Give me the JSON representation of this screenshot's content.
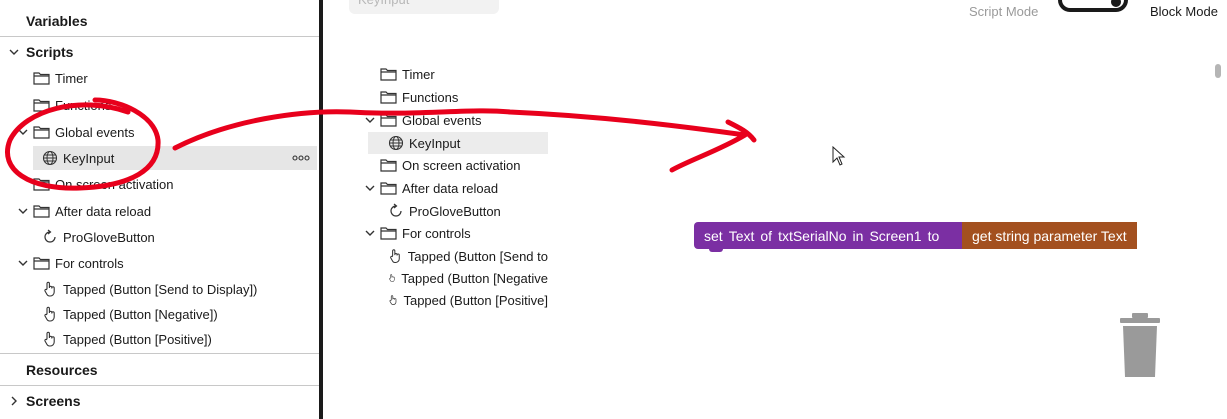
{
  "sidebar": {
    "variables_label": "Variables",
    "scripts_label": "Scripts",
    "resources_label": "Resources",
    "screens_label": "Screens",
    "items": [
      {
        "label": "Timer"
      },
      {
        "label": "Functions"
      },
      {
        "label": "Global events"
      },
      {
        "label": "KeyInput"
      },
      {
        "label": "On screen activation"
      },
      {
        "label": "After data reload"
      },
      {
        "label": "ProGloveButton"
      },
      {
        "label": "For controls"
      },
      {
        "label": "Tapped (Button [Send to Display])"
      },
      {
        "label": "Tapped (Button [Negative])"
      },
      {
        "label": "Tapped (Button [Positive])"
      }
    ],
    "more_label": "ooo"
  },
  "header": {
    "search_value": "KeyInput",
    "script_mode_label": "Script Mode",
    "block_mode_label": "Block Mode"
  },
  "tree": {
    "items": [
      {
        "label": "Timer"
      },
      {
        "label": "Functions"
      },
      {
        "label": "Global events"
      },
      {
        "label": "KeyInput"
      },
      {
        "label": "On screen activation"
      },
      {
        "label": "After data reload"
      },
      {
        "label": "ProGloveButton"
      },
      {
        "label": "For controls"
      },
      {
        "label": "Tapped (Button [Send to"
      },
      {
        "label": "Tapped (Button [Negative"
      },
      {
        "label": "Tapped (Button [Positive]"
      }
    ]
  },
  "blocks": {
    "set_words": [
      "set",
      "Text",
      "of",
      "txtSerialNo",
      "in",
      "Screen1",
      "to"
    ],
    "get_label": "get string parameter Text"
  },
  "colors": {
    "set_block": "#7b2fa3",
    "get_block": "#a3501f",
    "annotation": "#e8001c"
  },
  "icons": [
    "folder-icon",
    "globe-icon",
    "refresh-icon",
    "hand-pointer-icon",
    "chevron-down-icon",
    "chevron-right-icon",
    "trash-icon",
    "more-icon",
    "toggle-icon",
    "mouse-cursor-icon"
  ]
}
